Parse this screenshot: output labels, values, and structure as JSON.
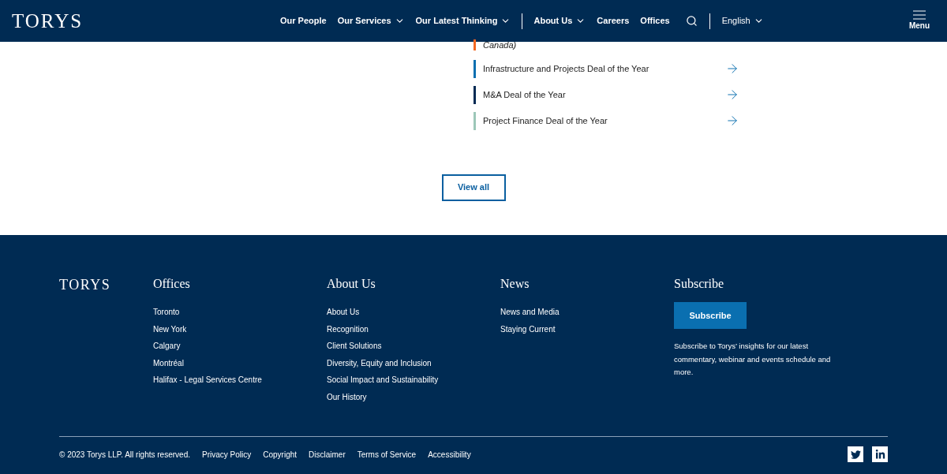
{
  "header": {
    "logo": "TORYS",
    "nav": [
      {
        "label": "Our People",
        "dropdown": false
      },
      {
        "label": "Our Services",
        "dropdown": true
      },
      {
        "label": "Our Latest Thinking",
        "dropdown": true
      }
    ],
    "secondary_nav": [
      {
        "label": "About Us",
        "dropdown": true
      },
      {
        "label": "Careers",
        "dropdown": false
      },
      {
        "label": "Offices",
        "dropdown": false
      }
    ],
    "language": "English",
    "menu": "Menu"
  },
  "awards": [
    {
      "label": "Canada)",
      "color": "#f26722",
      "italic": true,
      "arrow": false
    },
    {
      "label": "Infrastructure and Projects Deal of the Year",
      "color": "#0a6fb0",
      "italic": false,
      "arrow": true
    },
    {
      "label": "M&A Deal of the Year",
      "color": "#002a54",
      "italic": false,
      "arrow": true
    },
    {
      "label": "Project Finance Deal of the Year",
      "color": "#9cc7b8",
      "italic": false,
      "arrow": true
    }
  ],
  "view_all": "View all",
  "footer": {
    "logo": "TORYS",
    "columns": [
      {
        "title": "Offices",
        "links": [
          "Toronto",
          "New York",
          "Calgary",
          "Montréal",
          "Halifax - Legal Services Centre"
        ]
      },
      {
        "title": "About Us",
        "links": [
          "About Us",
          "Recognition",
          "Client Solutions",
          "Diversity, Equity and Inclusion",
          "Social Impact and Sustainability",
          "Our History"
        ]
      },
      {
        "title": "News",
        "links": [
          "News and Media",
          "Staying Current"
        ]
      }
    ],
    "subscribe": {
      "title": "Subscribe",
      "button": "Subscribe",
      "text": "Subscribe to Torys’ insights for our latest commentary, webinar and events schedule and more."
    },
    "copyright": "© 2023 Torys LLP. All rights reserved.",
    "legal_links": [
      "Privacy Policy",
      "Copyright",
      "Disclaimer",
      "Terms of Service",
      "Accessibility"
    ]
  }
}
